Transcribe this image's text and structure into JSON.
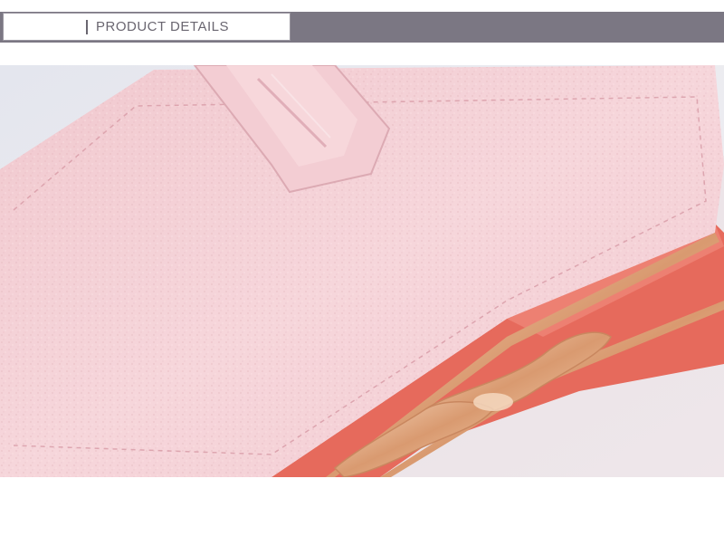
{
  "header": {
    "title": "PRODUCT DETAILS"
  },
  "photo": {
    "subject": "pink-leather-wallet-with-kiss-lock-clasp",
    "colors": {
      "background": "#dfe2ea",
      "leather": "#f4cfd4",
      "leather_shadow": "#e8b9c1",
      "interior": "#e66a5c",
      "clasp": "#e6b58d"
    }
  }
}
